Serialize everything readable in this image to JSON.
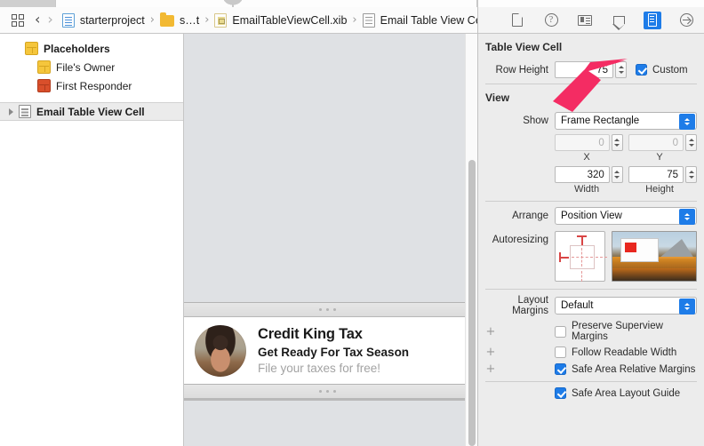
{
  "window": {
    "title": "Xcode Interface Builder"
  },
  "breadcrumb": {
    "jump_bar_icon": "grid-icon",
    "back_icon": "chevron-left-icon",
    "forward_icon": "chevron-right-icon",
    "separator": "›",
    "items": [
      {
        "label": "starterproject",
        "icon": "project-document-icon"
      },
      {
        "label": "s…t",
        "icon": "folder-icon"
      },
      {
        "label": "EmailTableViewCell.xib",
        "icon": "xib-file-icon"
      },
      {
        "label": "Email Table View Cell",
        "icon": "table-view-cell-icon"
      }
    ]
  },
  "outline": {
    "items": [
      {
        "label": "Placeholders",
        "icon": "yellow-cube-icon",
        "indent": 1,
        "bold": true,
        "selected": false,
        "disclosure": false
      },
      {
        "label": "File's Owner",
        "icon": "yellow-cube-icon",
        "indent": 2,
        "bold": false,
        "selected": false,
        "disclosure": false
      },
      {
        "label": "First Responder",
        "icon": "red-cube-icon",
        "indent": 2,
        "bold": false,
        "selected": false,
        "disclosure": false
      },
      {
        "label": "Email Table View Cell",
        "icon": "table-view-cell-icon",
        "indent": 0,
        "bold": true,
        "selected": true,
        "disclosure": true
      }
    ]
  },
  "canvas": {
    "cell": {
      "title": "Credit King Tax",
      "subject": "Get Ready For Tax Season",
      "preview": "File your taxes for free!",
      "avatar": "avatar-photo"
    }
  },
  "inspector": {
    "tabs": [
      {
        "name": "file-inspector-tab",
        "icon": "file-icon",
        "active": false
      },
      {
        "name": "quick-help-inspector-tab",
        "icon": "help-icon",
        "active": false
      },
      {
        "name": "identity-inspector-tab",
        "icon": "identity-card-icon",
        "active": false
      },
      {
        "name": "attributes-inspector-tab",
        "icon": "attributes-slider-icon",
        "active": false
      },
      {
        "name": "size-inspector-tab",
        "icon": "ruler-icon",
        "active": true
      },
      {
        "name": "connections-inspector-tab",
        "icon": "arrow-in-circle-icon",
        "active": false
      }
    ],
    "table_view_cell": {
      "section_title": "Table View Cell",
      "row_height_label": "Row Height",
      "row_height_value": "75",
      "custom_label": "Custom",
      "custom_checked": true
    },
    "view": {
      "section_title": "View",
      "show_label": "Show",
      "show_value": "Frame Rectangle",
      "x_value": "0",
      "x_caption": "X",
      "y_value": "0",
      "y_caption": "Y",
      "width_value": "320",
      "width_caption": "Width",
      "height_value": "75",
      "height_caption": "Height",
      "arrange_label": "Arrange",
      "arrange_value": "Position View",
      "autoresizing_label": "Autoresizing",
      "layout_margins_label": "Layout Margins",
      "layout_margins_value": "Default",
      "checkboxes": [
        {
          "label": "Preserve Superview Margins",
          "checked": false,
          "plus": true
        },
        {
          "label": "Follow Readable Width",
          "checked": false,
          "plus": true
        },
        {
          "label": "Safe Area Relative Margins",
          "checked": true,
          "plus": true
        },
        {
          "label": "Safe Area Layout Guide",
          "checked": true,
          "plus": false
        }
      ]
    }
  },
  "annotation": {
    "arrow_color": "#F42C63",
    "target": "row-height-stepper"
  }
}
